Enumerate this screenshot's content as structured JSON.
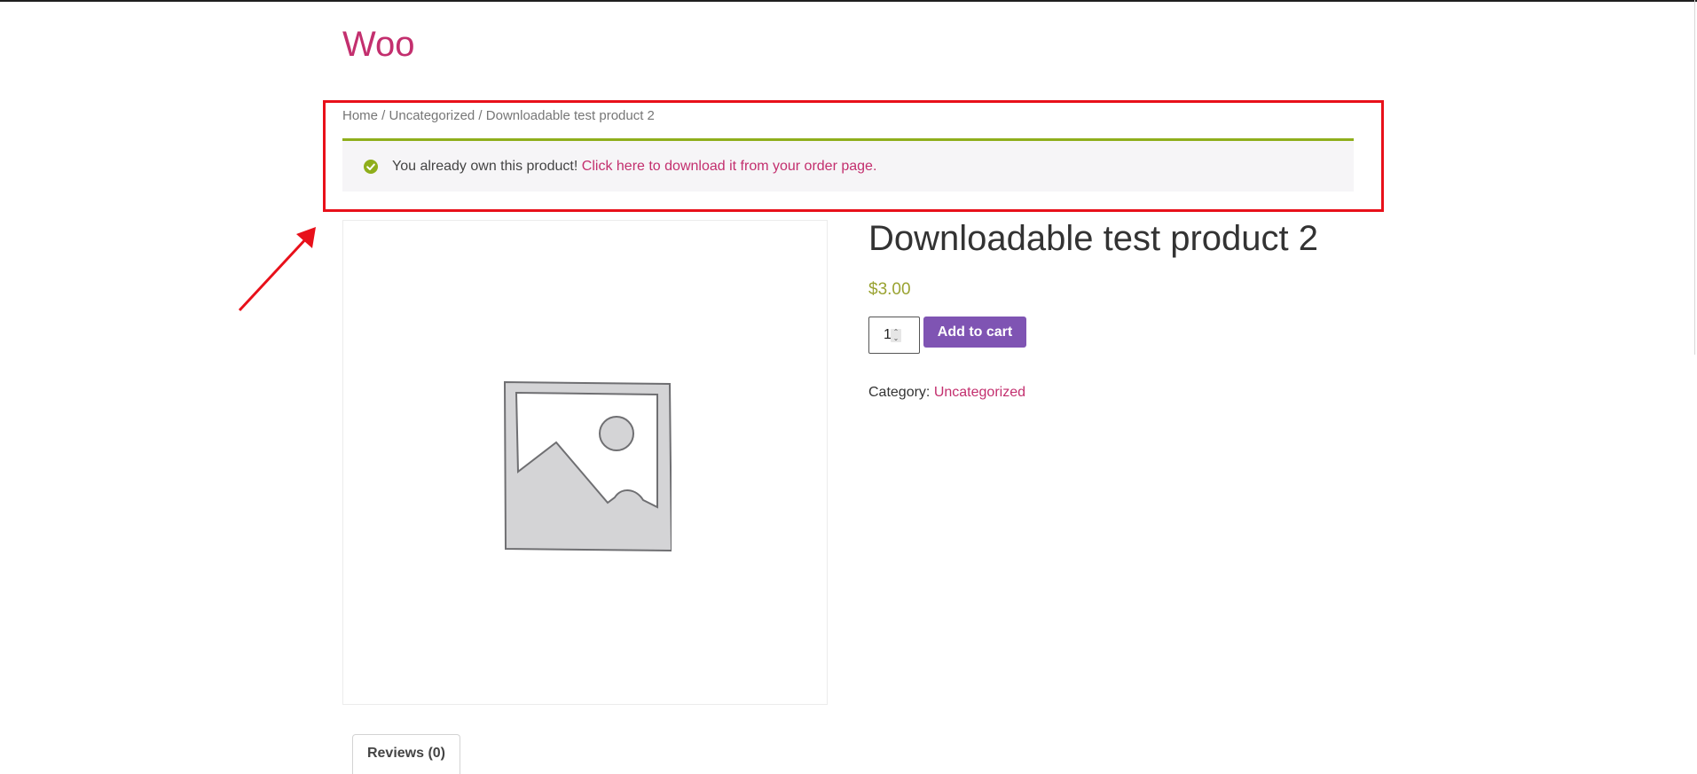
{
  "site": {
    "title": "Woo"
  },
  "breadcrumb": {
    "items": [
      "Home",
      "Uncategorized",
      "Downloadable test product 2"
    ],
    "separator": " / "
  },
  "notice": {
    "message": "You already own this product!",
    "link_text": "Click here to download it from your order page.",
    "icon": "check-circle-icon"
  },
  "product": {
    "title": "Downloadable test product 2",
    "price": "$3.00",
    "quantity": "1",
    "add_to_cart_label": "Add to cart",
    "category_label": "Category:",
    "category_value": "Uncategorized",
    "image_icon": "image-placeholder-icon"
  },
  "tabs": [
    {
      "label": "Reviews (0)"
    }
  ],
  "colors": {
    "brand_link": "#c32f6e",
    "notice_accent": "#8fae1b",
    "price": "#9aa332",
    "button": "#7f54b3",
    "annotation": "#e8101a"
  }
}
